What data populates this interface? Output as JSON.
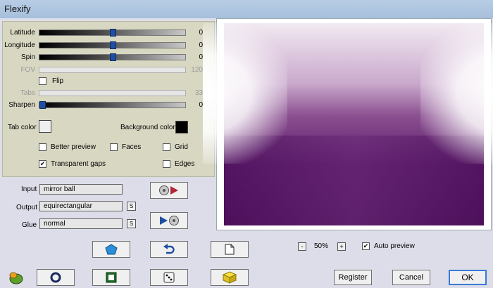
{
  "window": {
    "title": "Flexify"
  },
  "sliders": [
    {
      "label": "Latitude",
      "value": "0",
      "enabled": true
    },
    {
      "label": "Longitude",
      "value": "0",
      "enabled": true
    },
    {
      "label": "Spin",
      "value": "0",
      "enabled": true
    },
    {
      "label": "FOV",
      "value": "120",
      "enabled": false
    },
    {
      "label": "Tabs",
      "value": "33",
      "enabled": false
    },
    {
      "label": "Sharpen",
      "value": "0",
      "enabled": true
    }
  ],
  "checkboxes": {
    "flip": {
      "label": "Flip",
      "checked": false
    },
    "better_preview": {
      "label": "Better preview",
      "checked": false
    },
    "faces": {
      "label": "Faces",
      "checked": false
    },
    "grid": {
      "label": "Grid",
      "checked": false
    },
    "transparent_gaps": {
      "label": "Transparent gaps",
      "checked": true,
      "mark": "✔"
    },
    "edges": {
      "label": "Edges",
      "checked": false
    },
    "auto_preview": {
      "label": "Auto preview",
      "checked": true,
      "mark": "✔"
    }
  },
  "colors": {
    "tab_color_label": "Tab color",
    "tab_color": "#f0f0f0",
    "background_color_label": "Background color",
    "background_color": "#000000"
  },
  "projection": {
    "input_label": "Input",
    "input_value": "mirror ball",
    "output_label": "Output",
    "output_value": "equirectangular",
    "glue_label": "Glue",
    "glue_value": "normal",
    "s_label": "S"
  },
  "zoom": {
    "minus": "-",
    "value": "50%",
    "plus": "+"
  },
  "buttons": {
    "register": "Register",
    "cancel": "Cancel",
    "ok": "OK"
  },
  "icons": {
    "input_convert": "disc-to-arrow-icon",
    "output_convert": "arrow-to-disc-icon",
    "gem": "pentagon-gem-icon",
    "undo": "undo-arrow-icon",
    "page": "page-icon",
    "logo": "flexify-logo-icon",
    "ring": "ring-icon",
    "square": "square-frame-icon",
    "dice": "dice-icon",
    "cube": "yellow-cube-icon"
  }
}
